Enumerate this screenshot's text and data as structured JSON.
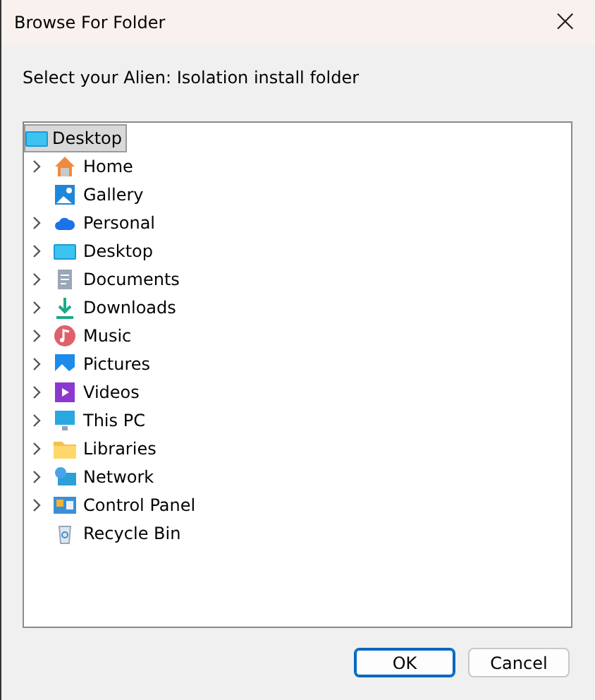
{
  "window": {
    "title": "Browse For Folder",
    "close": "×"
  },
  "instruction": "Select your Alien: Isolation install folder",
  "tree": {
    "root": {
      "label": "Desktop",
      "kind": "desktop",
      "selected": true,
      "children": [
        {
          "label": "Home",
          "kind": "home",
          "expandable": true,
          "selected": false
        },
        {
          "label": "Gallery",
          "kind": "gallery",
          "expandable": false,
          "selected": false
        },
        {
          "label": "Personal",
          "kind": "cloud",
          "expandable": true,
          "selected": false
        },
        {
          "label": "Desktop",
          "kind": "desktop",
          "expandable": true,
          "selected": false
        },
        {
          "label": "Documents",
          "kind": "documents",
          "expandable": true,
          "selected": false
        },
        {
          "label": "Downloads",
          "kind": "downloads",
          "expandable": true,
          "selected": false
        },
        {
          "label": "Music",
          "kind": "music",
          "expandable": true,
          "selected": false
        },
        {
          "label": "Pictures",
          "kind": "pictures",
          "expandable": true,
          "selected": false
        },
        {
          "label": "Videos",
          "kind": "videos",
          "expandable": true,
          "selected": false
        },
        {
          "label": "This PC",
          "kind": "pc",
          "expandable": true,
          "selected": false
        },
        {
          "label": "Libraries",
          "kind": "folder",
          "expandable": true,
          "selected": false
        },
        {
          "label": "Network",
          "kind": "network",
          "expandable": true,
          "selected": false
        },
        {
          "label": "Control Panel",
          "kind": "control",
          "expandable": true,
          "selected": false
        },
        {
          "label": "Recycle Bin",
          "kind": "recycle",
          "expandable": false,
          "selected": false
        }
      ]
    }
  },
  "buttons": [
    {
      "label": "OK",
      "default": true
    },
    {
      "label": "Cancel",
      "default": false
    }
  ]
}
